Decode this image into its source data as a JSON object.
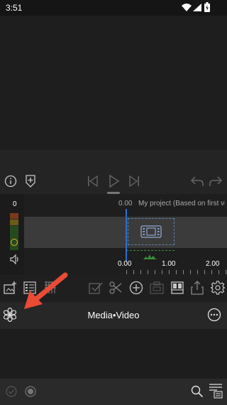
{
  "status_bar": {
    "time": "3:51"
  },
  "meter": {
    "level": "0"
  },
  "timeline": {
    "current_time": "0.00",
    "project_title": "My project (Based on first vide...",
    "ruler": [
      "0.00",
      "1.00",
      "2.00"
    ]
  },
  "media": {
    "title": "Media•Video"
  },
  "colors": {
    "background": "#1b1b1b",
    "accent_arrow": "#e94b35",
    "playhead": "#2c6fd1",
    "audio_green": "#3c8f3c"
  }
}
